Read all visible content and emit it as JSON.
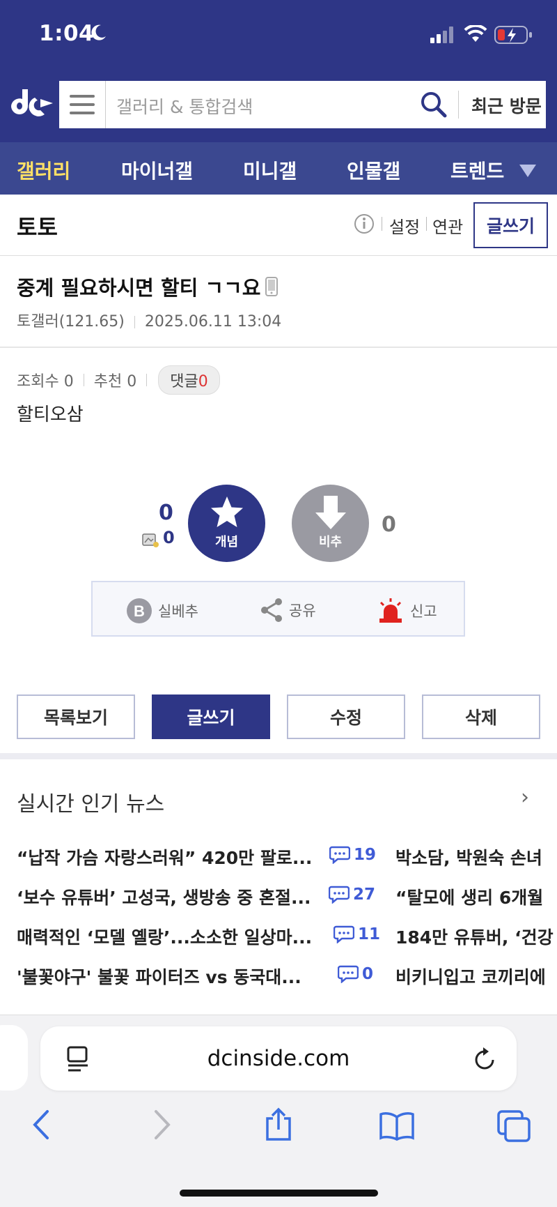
{
  "status": {
    "time": "1:04"
  },
  "header": {
    "search_placeholder": "갤러리 & 통합검색",
    "recent_label": "최근 방문"
  },
  "nav": {
    "items": [
      "갤러리",
      "마이너갤",
      "미니갤",
      "인물갤",
      "트렌드"
    ]
  },
  "gallery": {
    "name": "토토",
    "links": [
      "설정",
      "연관"
    ],
    "write_label": "글쓰기"
  },
  "post": {
    "title": "중계 필요하시면 할티 ㄱㄱ요",
    "author": "토갤러(121.65)",
    "date": "2025.06.11 13:04",
    "views_label": "조회수 0",
    "recommend_label": "추천 0",
    "comments_label": "댓글",
    "comments_count": "0",
    "body": "할티오삼"
  },
  "votes": {
    "up_count": "0",
    "fix_count": "0",
    "up_label": "개념",
    "down_label": "비추",
    "down_count": "0"
  },
  "actions": {
    "silbe": "실베추",
    "share": "공유",
    "report": "신고"
  },
  "buttons": {
    "list": "목록보기",
    "write": "글쓰기",
    "edit": "수정",
    "delete": "삭제"
  },
  "news": {
    "title": "실시간 인기 뉴스",
    "items": [
      {
        "left": "“납작 가슴 자랑스러워” 420만 팔로...",
        "comments": "19",
        "right": "박소담, 박원숙 손녀"
      },
      {
        "left": "‘보수 유튜버’ 고성국, 생방송 중 혼절...",
        "comments": "27",
        "right": "“탈모에 생리 6개월"
      },
      {
        "left": "매력적인 ‘모델 옐랑’...소소한 일상마...",
        "comments": "11",
        "right": "184만 유튜버, ‘건강"
      },
      {
        "left": "'불꽃야구' 불꽃 파이터즈 vs 동국대...",
        "comments": "0",
        "right": "비키니입고 코끼리에"
      }
    ]
  },
  "browser": {
    "url": "dcinside.com"
  },
  "colors": {
    "brand": "#2e3686",
    "nav": "#3b4890",
    "active_nav": "#ffe066",
    "comment_blue": "#3f5bd6"
  }
}
